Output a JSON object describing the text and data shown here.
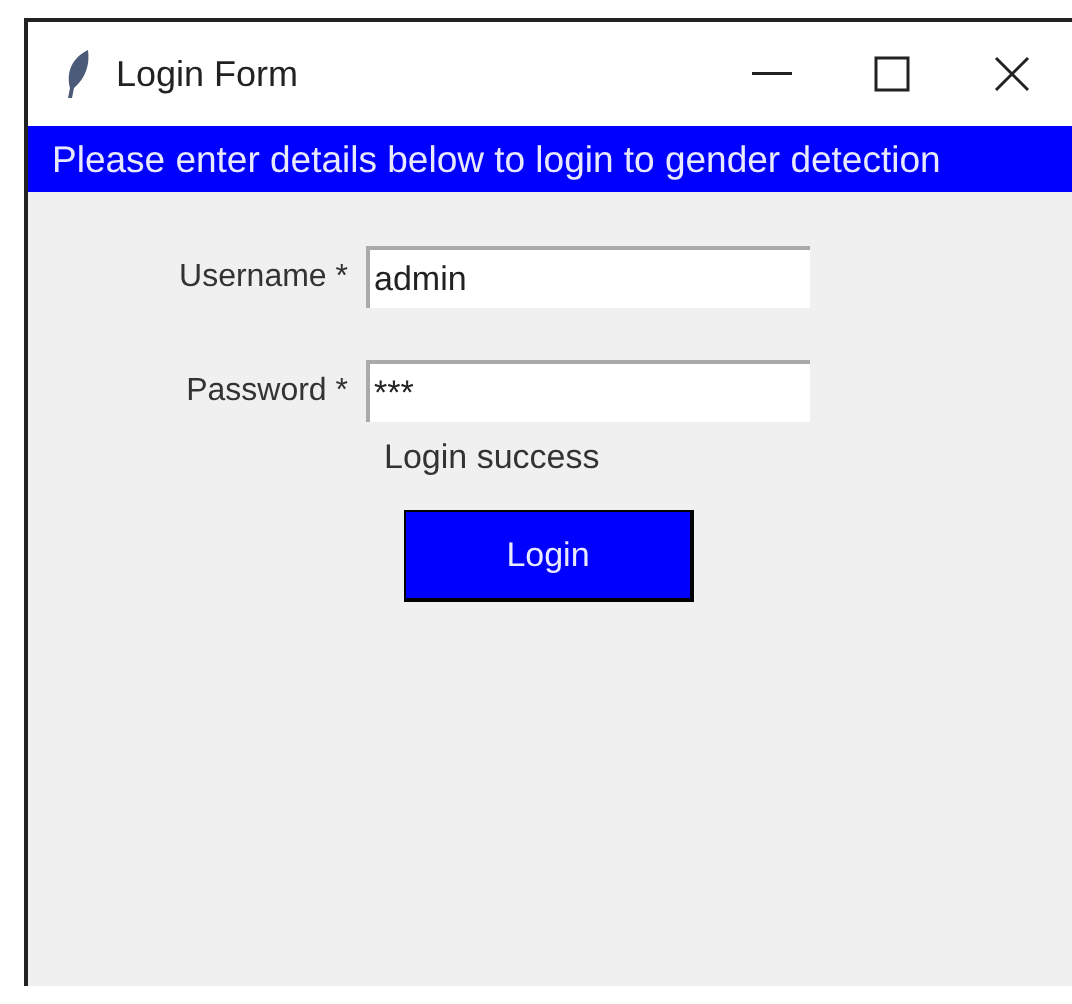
{
  "window": {
    "title": "Login Form"
  },
  "banner": "Please enter details below to login to gender detection",
  "fields": [
    {
      "label": "Username *",
      "value": "admin"
    },
    {
      "label": "Password *",
      "value": "***"
    }
  ],
  "message": "Login success",
  "buttons": [
    "Login"
  ]
}
